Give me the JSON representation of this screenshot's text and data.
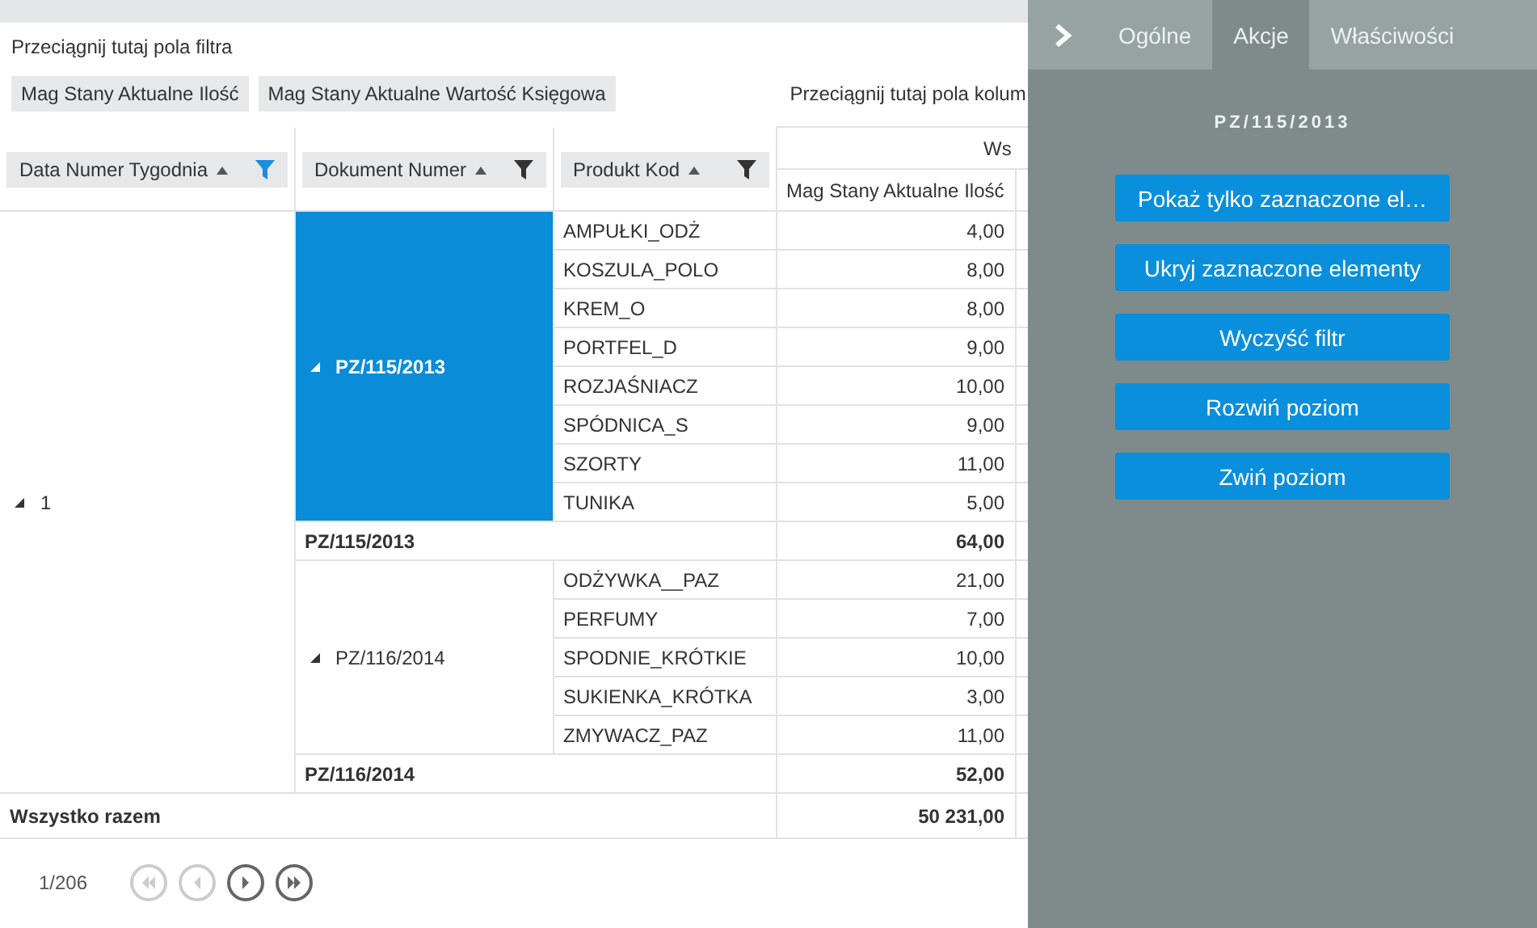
{
  "filter_area": {
    "hint": "Przeciągnij tutaj pola filtra"
  },
  "data_fields": [
    "Mag Stany Aktualne Ilość",
    "Mag Stany Aktualne Wartość Księgowa"
  ],
  "column_area": {
    "hint": "Przeciągnij tutaj pola kolum"
  },
  "row_fields": [
    {
      "label": "Data Numer Tygodnia",
      "filter_active": true
    },
    {
      "label": "Dokument Numer",
      "filter_active": false
    },
    {
      "label": "Produkt Kod",
      "filter_active": false
    }
  ],
  "column_header": "Ws",
  "value_header": "Mag Stany Aktualne Ilość",
  "weeks": [
    {
      "label": "1",
      "expanded": true,
      "documents": [
        {
          "label": "PZ/115/2013",
          "expanded": true,
          "selected": true,
          "total_label": "PZ/115/2013",
          "total": "64,00",
          "products": [
            {
              "code": "AMPUŁKI_ODŻ",
              "value": "4,00"
            },
            {
              "code": "KOSZULA_POLO",
              "value": "8,00"
            },
            {
              "code": "KREM_O",
              "value": "8,00"
            },
            {
              "code": "PORTFEL_D",
              "value": "9,00"
            },
            {
              "code": "ROZJAŚNIACZ",
              "value": "10,00"
            },
            {
              "code": "SPÓDNICA_S",
              "value": "9,00"
            },
            {
              "code": "SZORTY",
              "value": "11,00"
            },
            {
              "code": "TUNIKA",
              "value": "5,00"
            }
          ]
        },
        {
          "label": "PZ/116/2014",
          "expanded": true,
          "selected": false,
          "total_label": "PZ/116/2014",
          "total": "52,00",
          "products": [
            {
              "code": "ODŻYWKA__PAZ",
              "value": "21,00"
            },
            {
              "code": "PERFUMY",
              "value": "7,00"
            },
            {
              "code": "SPODNIE_KRÓTKIE",
              "value": "10,00"
            },
            {
              "code": "SUKIENKA_KRÓTKA",
              "value": "3,00"
            },
            {
              "code": "ZMYWACZ_PAZ",
              "value": "11,00"
            }
          ]
        }
      ]
    }
  ],
  "grand_total": {
    "label": "Wszystko razem",
    "value": "50 231,00"
  },
  "pager": {
    "page": "1/206",
    "first_enabled": false,
    "prev_enabled": false,
    "next_enabled": true,
    "last_enabled": true
  },
  "panel": {
    "tabs": [
      {
        "label": "Ogólne",
        "selected": false
      },
      {
        "label": "Akcje",
        "selected": true
      },
      {
        "label": "Właściwości",
        "selected": false
      }
    ],
    "title": "PZ/115/2013",
    "actions": [
      "Pokaż tylko zaznaczone el…",
      "Ukryj zaznaczone elementy",
      "Wyczyść filtr",
      "Rozwiń poziom",
      "Zwiń poziom"
    ]
  }
}
